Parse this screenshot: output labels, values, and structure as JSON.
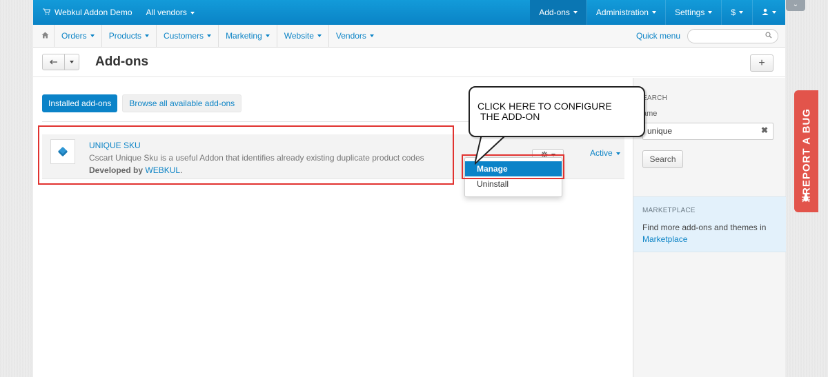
{
  "topbar": {
    "brand": "Webkul Addon Demo",
    "vendors": "All vendors",
    "addons": "Add-ons",
    "administration": "Administration",
    "settings": "Settings",
    "currency": "$"
  },
  "navbar": {
    "items": [
      "Orders",
      "Products",
      "Customers",
      "Marketing",
      "Website",
      "Vendors"
    ],
    "quick_menu": "Quick menu"
  },
  "page": {
    "title": "Add-ons"
  },
  "tabs": {
    "installed": "Installed add-ons",
    "browse": "Browse all available add-ons"
  },
  "addon": {
    "name": "UNIQUE SKU",
    "description": "Cscart Unique Sku is a useful Addon that identifies already existing duplicate product codes",
    "developed_by": "Developed by",
    "developer": "WEBKUL",
    "status": "Active"
  },
  "dropdown": {
    "manage": "Manage",
    "uninstall": "Uninstall"
  },
  "callout": {
    "line1": "CLICK HERE TO CONFIGURE",
    "line2": "THE ADD-ON"
  },
  "sidebar": {
    "search_label": "EARCH",
    "name_label": "ame",
    "name_value": "unique",
    "search_button": "Search",
    "marketplace_label": "MARKETPLACE",
    "marketplace_text": "Find more add-ons and themes in",
    "marketplace_link": "Marketplace"
  },
  "report_bug": "REPORT A BUG",
  "colors": {
    "primary": "#0b83c8",
    "highlight": "#e1322f",
    "bug_tab": "#e2544b"
  }
}
